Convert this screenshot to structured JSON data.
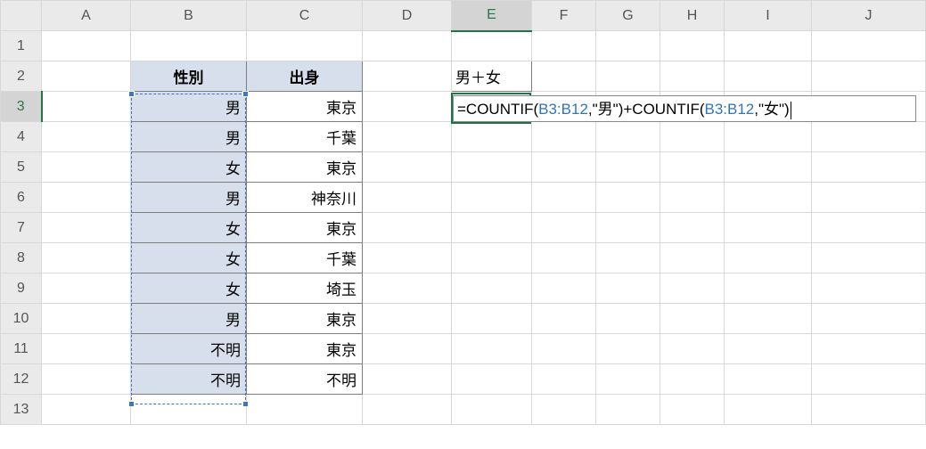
{
  "columns": [
    "A",
    "B",
    "C",
    "D",
    "E",
    "F",
    "G",
    "H",
    "I",
    "J"
  ],
  "rows": [
    "1",
    "2",
    "3",
    "4",
    "5",
    "6",
    "7",
    "8",
    "9",
    "10",
    "11",
    "12",
    "13"
  ],
  "active_column": "E",
  "active_row": "3",
  "table": {
    "headers": {
      "B": "性別",
      "C": "出身"
    },
    "rows": [
      {
        "B": "男",
        "C": "東京"
      },
      {
        "B": "男",
        "C": "千葉"
      },
      {
        "B": "女",
        "C": "東京"
      },
      {
        "B": "男",
        "C": "神奈川"
      },
      {
        "B": "女",
        "C": "東京"
      },
      {
        "B": "女",
        "C": "千葉"
      },
      {
        "B": "女",
        "C": "埼玉"
      },
      {
        "B": "男",
        "C": "東京"
      },
      {
        "B": "不明",
        "C": "東京"
      },
      {
        "B": "不明",
        "C": "不明"
      }
    ]
  },
  "E2": "男＋女",
  "formula_cell": "E3",
  "formula_parts": {
    "p0": "=COUNTIF(",
    "ref1": "B3:B12",
    "p1": ",\"男\")+COUNTIF(",
    "ref2": "B3:B12",
    "p2": ",\"女\")"
  },
  "selected_range": "B3:B12",
  "chart_data": null
}
